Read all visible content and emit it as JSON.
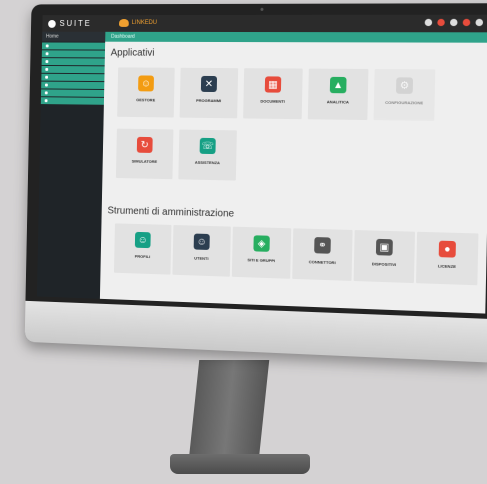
{
  "topbar": {
    "brand": "SUITE",
    "app_name": "LINKEDU"
  },
  "sidebar": {
    "home_label": "Home",
    "items": [
      {
        "label": ""
      },
      {
        "label": ""
      },
      {
        "label": ""
      },
      {
        "label": ""
      },
      {
        "label": ""
      },
      {
        "label": ""
      },
      {
        "label": ""
      },
      {
        "label": ""
      }
    ]
  },
  "breadcrumb": "Dashboard",
  "sections": {
    "apps_title": "Applicativi",
    "admin_title": "Strumenti di amministrazione"
  },
  "apps": [
    {
      "title": "GESTORE",
      "desc": "",
      "icon": "person-icon",
      "color": "#f39c12"
    },
    {
      "title": "PROGRAMMI",
      "desc": "",
      "icon": "tools-icon",
      "color": "#2c3e50"
    },
    {
      "title": "DOCUMENTI",
      "desc": "",
      "icon": "documents-icon",
      "color": "#e74c3c"
    },
    {
      "title": "ANALITICA",
      "desc": "",
      "icon": "chart-icon",
      "color": "#27ae60"
    },
    {
      "title": "CONFIGURAZIONE",
      "desc": "",
      "icon": "gear-icon",
      "color": "#bdbdbd"
    },
    {
      "title": "SIMULATORE",
      "desc": "",
      "icon": "cycle-icon",
      "color": "#e74c3c"
    },
    {
      "title": "ASSISTENZA",
      "desc": "",
      "icon": "support-icon",
      "color": "#16a085"
    }
  ],
  "admin": [
    {
      "title": "PROFILI",
      "desc": "",
      "icon": "user-icon",
      "color": "#16a085"
    },
    {
      "title": "UTENTI",
      "desc": "",
      "icon": "user-icon",
      "color": "#2c3e50"
    },
    {
      "title": "SITI E GRUPPI",
      "desc": "",
      "icon": "map-icon",
      "color": "#27ae60"
    },
    {
      "title": "CONNETTORI",
      "desc": "",
      "icon": "connector-icon",
      "color": "#555555"
    },
    {
      "title": "DISPOSITIVI",
      "desc": "",
      "icon": "device-icon",
      "color": "#555555"
    },
    {
      "title": "LICENZE",
      "desc": "",
      "icon": "license-icon",
      "color": "#e74c3c"
    }
  ],
  "colors": {
    "accent": "#2fa38a",
    "topbar": "#2b2b2b",
    "sidebar": "#1f2428"
  }
}
